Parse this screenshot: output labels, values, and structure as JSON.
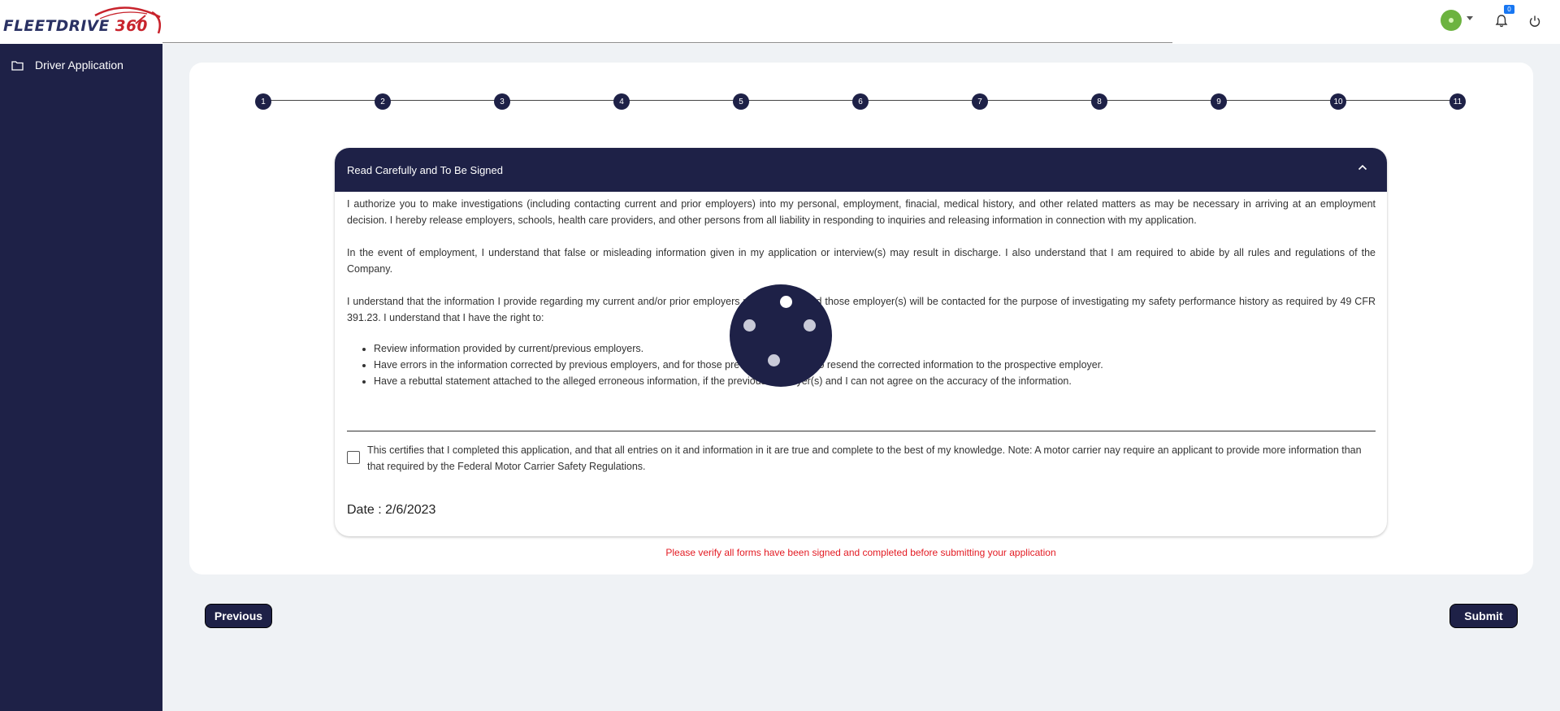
{
  "header": {
    "logo_text_main": "FLEETDRIVE",
    "logo_text_num": "360",
    "notification_count": "0",
    "colors": {
      "brand_navy": "#1e2147",
      "accent_red": "#c8232c",
      "avatar_green": "#6cb33f",
      "badge_blue": "#1877f2"
    }
  },
  "sidebar": {
    "items": [
      {
        "label": "Driver Application",
        "icon": "folder-icon"
      }
    ]
  },
  "stepper": {
    "steps": [
      "1",
      "2",
      "3",
      "4",
      "5",
      "6",
      "7",
      "8",
      "9",
      "10",
      "11"
    ]
  },
  "accordion": {
    "title": "Read Carefully and To Be Signed",
    "paragraphs": [
      "I authorize you to make investigations (including contacting current and prior employers) into my personal, employment, finacial, medical history, and other related matters as may be necessary in arriving at an employment decision. I hereby release employers, schools, health care providers, and other persons from all liability in responding to inquiries and releasing information in connection with my application.",
      "In the event of employment, I understand that false or misleading information given in my application or interview(s) may result in discharge. I also understand that I am required to abide by all rules and regulations of the Company.",
      "I understand that the information I provide regarding my current and/or prior employers may be used and those employer(s) will be contacted for the purpose of investigating my safety performance history as required by 49 CFR 391.23. I understand that I have the right to:"
    ],
    "bullets": [
      "Review information provided by current/previous employers.",
      "Have errors in the information corrected by previous employers, and for those previous employers to resend the corrected information to the prospective employer.",
      "Have a rebuttal statement attached to the alleged erroneous information, if the previous employer(s) and I can not agree on the accuracy of the information."
    ],
    "certification": "This certifies that I completed this application, and that all entries on it and information in it are true and complete to the best of my knowledge. Note: A motor carrier nay require an applicant to provide more information than that required by the Federal Motor Carrier Safety Regulations.",
    "date_label": "Date :",
    "date_value": "2/6/2023"
  },
  "warning": "Please verify all forms have been signed and completed before submitting your application",
  "buttons": {
    "previous": "Previous",
    "submit": "Submit"
  }
}
